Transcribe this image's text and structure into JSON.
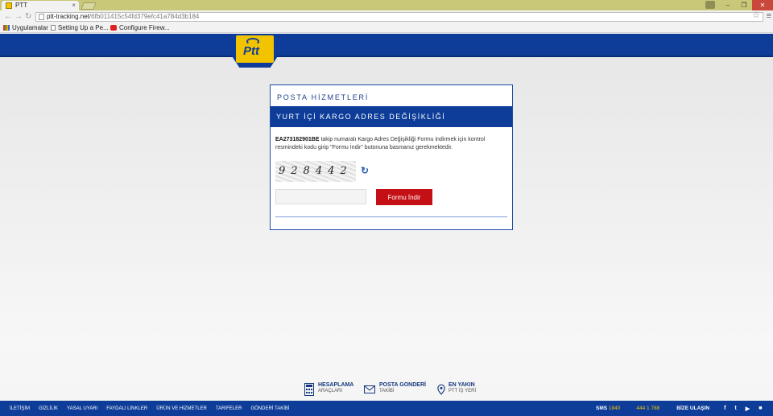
{
  "browser": {
    "tab_title": "PTT",
    "tab_close": "×",
    "url_host": "ptt-tracking.net",
    "url_path": "/6fb011415c54fd379efc41a784d3b184",
    "bookmarks": [
      {
        "label": "Uygulamalar",
        "icon": "apps-grid-icon"
      },
      {
        "label": "Setting Up a Pe...",
        "icon": "page-icon"
      },
      {
        "label": "Configure Firew...",
        "icon": "youtube-icon"
      }
    ],
    "controls": {
      "minimize": "–",
      "maximize": "❐",
      "close": "✕"
    }
  },
  "header": {
    "logo_text": "Ptt",
    "brand_color": "#0d3d99",
    "logo_color": "#f2c400"
  },
  "card": {
    "title": "POSTA HİZMETLERİ",
    "band_title": "YURT İÇİ KARGO ADRES DEĞİŞİKLİĞİ",
    "tracking_number": "EA273182901BE",
    "description": " takip numaralı Kargo Adres Değişikliği Formu indirmek için kontrol resmindeki kodu girip \"Formu İndir\" butonuna basmanız gerekmektedir.",
    "captcha_text": "928442",
    "code_input_value": "",
    "submit_label": "Formu İndir",
    "submit_color": "#c41014"
  },
  "quick_links": [
    {
      "title": "HESAPLAMA",
      "subtitle": "ARAÇLARI",
      "icon": "calculator-icon"
    },
    {
      "title": "POSTA GONDERİ",
      "subtitle": "TAKİBİ",
      "icon": "envelope-icon"
    },
    {
      "title": "EN YAKIN",
      "subtitle": "PTT İŞ YERİ",
      "icon": "location-pin-icon"
    }
  ],
  "footer": {
    "links": [
      "İLETİŞİM",
      "GİZLİLİK",
      "YASAL UYARI",
      "FAYDALI LİNKLER",
      "ÜRÜN VE HİZMETLER",
      "TARİFELER",
      "GÖNDERİ TAKİBİ"
    ],
    "sms_label": "SMS",
    "sms_number": "1840",
    "phone": "444 1 788",
    "contact_label": "BİZE ULAŞIN",
    "social": [
      "f",
      "t",
      "▶",
      "■"
    ]
  }
}
